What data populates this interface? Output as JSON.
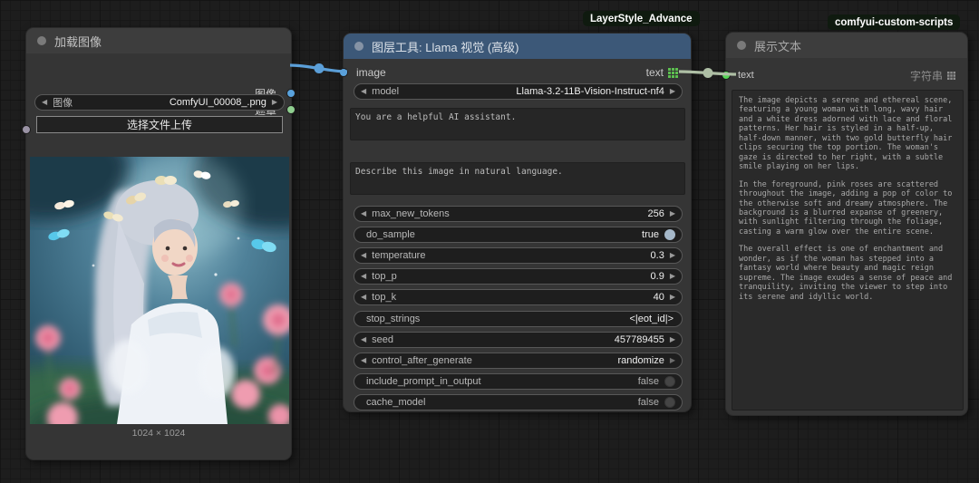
{
  "badges": {
    "layerstyle": "LayerStyle_Advance",
    "custom_scripts": "comfyui-custom-scripts"
  },
  "colors": {
    "image_slot": "#59a2dd",
    "mask_slot": "#8fce8f",
    "text_slot_green": "#55d455",
    "wire_blue": "#5b9fd8",
    "wire_green": "#aebfa5",
    "llama_header": "#3c5878"
  },
  "load_image_node": {
    "title": "加载图像",
    "output_image_label": "图像",
    "output_mask_label": "遮罩",
    "image_widget": {
      "label": "图像",
      "value": "ComfyUI_00008_.png"
    },
    "upload_button": "选择文件上传",
    "caption": "1024 × 1024"
  },
  "llama_node": {
    "title": "图层工具: Llama 视觉 (高级)",
    "input_label": "image",
    "output_label": "text",
    "model_widget": {
      "label": "model",
      "value": "Llama-3.2-11B-Vision-Instruct-nf4"
    },
    "system_prompt": "You are a helpful AI assistant.",
    "user_prompt": "Describe this image in natural language.",
    "widgets": [
      {
        "label": "max_new_tokens",
        "value": "256"
      },
      {
        "label": "do_sample",
        "value": "true"
      },
      {
        "label": "temperature",
        "value": "0.3"
      },
      {
        "label": "top_p",
        "value": "0.9"
      },
      {
        "label": "top_k",
        "value": "40"
      },
      {
        "label": "stop_strings",
        "value": "<|eot_id|>"
      },
      {
        "label": "seed",
        "value": "457789455"
      },
      {
        "label": "control_after_generate",
        "value": "randomize"
      },
      {
        "label": "include_prompt_in_output",
        "value": "false"
      },
      {
        "label": "cache_model",
        "value": "false"
      }
    ]
  },
  "show_text_node": {
    "title": "展示文本",
    "input_label": "text",
    "type_label": "字符串",
    "paragraphs": {
      "p1": "The image depicts a serene and ethereal scene, featuring a young woman with long, wavy hair and a white dress adorned with lace and floral patterns. Her hair is styled in a half-up, half-down manner, with two gold butterfly hair clips securing the top portion. The woman's gaze is directed to her right, with a subtle smile playing on her lips.",
      "p2": "In the foreground, pink roses are scattered throughout the image, adding a pop of color to the otherwise soft and dreamy atmosphere. The background is a blurred expanse of greenery, with sunlight filtering through the foliage, casting a warm glow over the entire scene.",
      "p3": "The overall effect is one of enchantment and wonder, as if the woman has stepped into a fantasy world where beauty and magic reign supreme. The image exudes a sense of peace and tranquility, inviting the viewer to step into its serene and idyllic world."
    }
  }
}
